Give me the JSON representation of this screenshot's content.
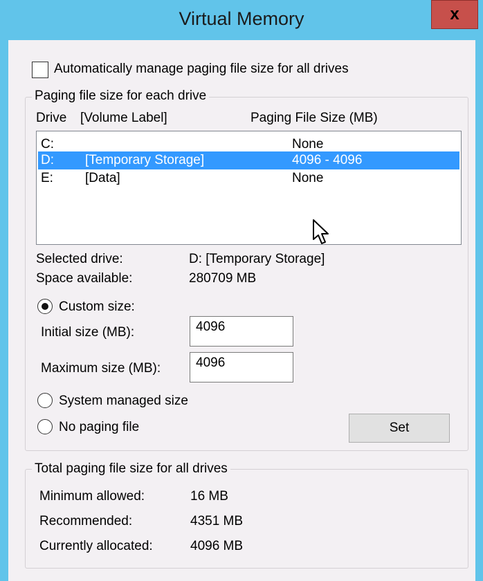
{
  "window": {
    "title": "Virtual Memory",
    "close_glyph": "x"
  },
  "auto_manage": {
    "label": "Automatically manage paging file size for all drives",
    "checked": false
  },
  "drive_group": {
    "legend": "Paging file size for each drive",
    "headers": {
      "drive": "Drive",
      "volume_label": "[Volume Label]",
      "paging_size": "Paging File Size (MB)"
    },
    "rows": [
      {
        "drive": "C:",
        "label": "",
        "size": "None",
        "selected": false
      },
      {
        "drive": "D:",
        "label": "[Temporary Storage]",
        "size": "4096 - 4096",
        "selected": true
      },
      {
        "drive": "E:",
        "label": "[Data]",
        "size": "None",
        "selected": false
      }
    ],
    "selected_drive_label": "Selected drive:",
    "selected_drive_value": "D:  [Temporary Storage]",
    "space_available_label": "Space available:",
    "space_available_value": "280709 MB",
    "custom_size_label": "Custom size:",
    "initial_size_label": "Initial size (MB):",
    "initial_size_value": "4096",
    "maximum_size_label": "Maximum size (MB):",
    "maximum_size_value": "4096",
    "system_managed_label": "System managed size",
    "no_paging_label": "No paging file",
    "selected_option": "custom",
    "set_button": "Set"
  },
  "total_group": {
    "legend": "Total paging file size for all drives",
    "minimum_label": "Minimum allowed:",
    "minimum_value": "16 MB",
    "recommended_label": "Recommended:",
    "recommended_value": "4351 MB",
    "allocated_label": "Currently allocated:",
    "allocated_value": "4096 MB"
  },
  "colors": {
    "title_bar": "#61c4ea",
    "close_button": "#c7504b",
    "selection": "#3399ff",
    "dialog_background": "#f3f0f3"
  },
  "icons": {
    "close": "close-icon",
    "cursor": "mouse-pointer-icon"
  }
}
